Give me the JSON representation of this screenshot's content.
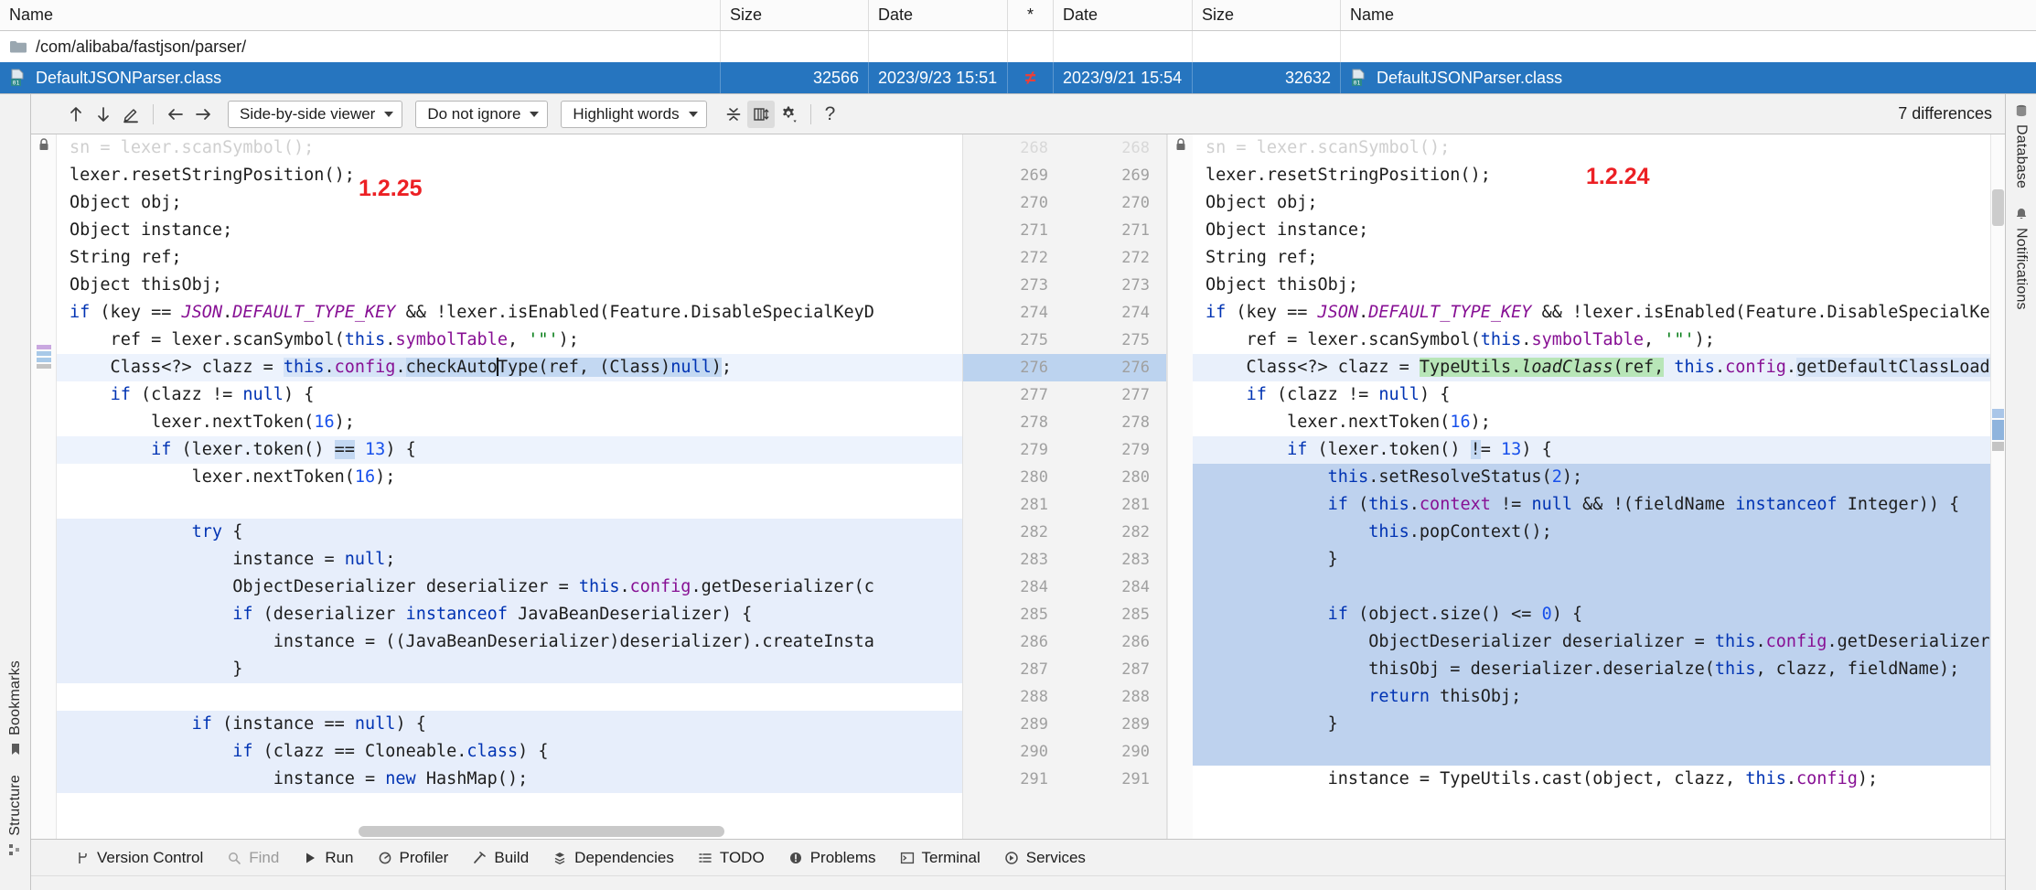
{
  "file_table": {
    "columns": [
      "Name",
      "Size",
      "Date",
      "*",
      "Date",
      "Size",
      "Name"
    ],
    "folder_row": {
      "path": "/com/alibaba/fastjson/parser/"
    },
    "selected_row": {
      "left_name": "DefaultJSONParser.class",
      "left_size": "32566",
      "left_date": "2023/9/23 15:51",
      "status": "≠",
      "right_date": "2023/9/21 15:54",
      "right_size": "32632",
      "right_name": "DefaultJSONParser.class"
    }
  },
  "toolbar": {
    "prev_difference": "previous-difference",
    "next_difference": "next-difference",
    "annotate": "annotate",
    "prev_file": "previous-file",
    "next_file": "next-file",
    "viewer_mode": "Side-by-side viewer",
    "ignore_mode": "Do not ignore",
    "highlight_mode": "Highlight words",
    "collapse_label": "collapse-unchanged-fragments",
    "sync_label": "synchronize-scrolling",
    "settings_label": "settings",
    "help_label": "?",
    "differences": "7 differences"
  },
  "left_rail": {
    "items": [
      {
        "label": "Bookmarks",
        "icon": "bookmark-icon"
      },
      {
        "label": "Structure",
        "icon": "structure-icon"
      }
    ]
  },
  "right_rail": {
    "items": [
      {
        "label": "Database",
        "icon": "database-icon"
      },
      {
        "label": "Notifications",
        "icon": "bell-icon"
      }
    ]
  },
  "diff": {
    "left_version_tag": "1.2.25",
    "right_version_tag": "1.2.24",
    "line_numbers": [
      "",
      "269",
      "270",
      "271",
      "272",
      "273",
      "274",
      "275",
      "276",
      "277",
      "278",
      "279",
      "280",
      "281",
      "282",
      "283",
      "284",
      "285",
      "286",
      "287",
      "288",
      "289",
      "290",
      "291"
    ],
    "left_lines": [
      {
        "text": "sn = lexer.scanSymbol();",
        "state": "dim"
      },
      {
        "text": "lexer.resetStringPosition();",
        "state": "normal"
      },
      {
        "text": "Object obj;",
        "state": "normal"
      },
      {
        "text": "Object instance;",
        "state": "normal"
      },
      {
        "text": "String ref;",
        "state": "normal"
      },
      {
        "text": "Object thisObj;",
        "state": "normal"
      },
      {
        "text": "if (key == JSON.DEFAULT_TYPE_KEY && !lexer.isEnabled(Feature.DisableSpecialKeyD",
        "state": "normal"
      },
      {
        "text": "    ref = lexer.scanSymbol(this.symbolTable, '\"');",
        "state": "normal"
      },
      {
        "text": "    Class<?> clazz = this.config.checkAutoType(ref, (Class)null);",
        "state": "changed"
      },
      {
        "text": "    if (clazz != null) {",
        "state": "normal"
      },
      {
        "text": "        lexer.nextToken(16);",
        "state": "normal"
      },
      {
        "text": "        if (lexer.token() == 13) {",
        "state": "changed-word"
      },
      {
        "text": "            lexer.nextToken(16);",
        "state": "normal"
      },
      {
        "text": "",
        "state": "normal"
      },
      {
        "text": "            try {",
        "state": "block"
      },
      {
        "text": "                instance = null;",
        "state": "block"
      },
      {
        "text": "                ObjectDeserializer deserializer = this.config.getDeserializer(c",
        "state": "block"
      },
      {
        "text": "                if (deserializer instanceof JavaBeanDeserializer) {",
        "state": "block"
      },
      {
        "text": "                    instance = ((JavaBeanDeserializer)deserializer).createInsta",
        "state": "block"
      },
      {
        "text": "                }",
        "state": "block"
      },
      {
        "text": "",
        "state": "normal"
      },
      {
        "text": "            if (instance == null) {",
        "state": "block"
      },
      {
        "text": "                if (clazz == Cloneable.class) {",
        "state": "block"
      },
      {
        "text": "                    instance = new HashMap();",
        "state": "block"
      }
    ],
    "right_lines": [
      {
        "text": "sn = lexer.scanSymbol();",
        "state": "dim"
      },
      {
        "text": "lexer.resetStringPosition();",
        "state": "normal"
      },
      {
        "text": "Object obj;",
        "state": "normal"
      },
      {
        "text": "Object instance;",
        "state": "normal"
      },
      {
        "text": "String ref;",
        "state": "normal"
      },
      {
        "text": "Object thisObj;",
        "state": "normal"
      },
      {
        "text": "if (key == JSON.DEFAULT_TYPE_KEY && !lexer.isEnabled(Feature.DisableSpecialKeyDet",
        "state": "normal"
      },
      {
        "text": "    ref = lexer.scanSymbol(this.symbolTable, '\"');",
        "state": "normal"
      },
      {
        "text": "    Class<?> clazz = TypeUtils.loadClass(ref, this.config.getDefaultClassLoader()",
        "state": "changed"
      },
      {
        "text": "    if (clazz != null) {",
        "state": "normal"
      },
      {
        "text": "        lexer.nextToken(16);",
        "state": "normal"
      },
      {
        "text": "        if (lexer.token() != 13) {",
        "state": "changed-word"
      },
      {
        "text": "            this.setResolveStatus(2);",
        "state": "block"
      },
      {
        "text": "            if (this.context != null && !(fieldName instanceof Integer)) {",
        "state": "block"
      },
      {
        "text": "                this.popContext();",
        "state": "block"
      },
      {
        "text": "            }",
        "state": "block"
      },
      {
        "text": "",
        "state": "block"
      },
      {
        "text": "            if (object.size() <= 0) {",
        "state": "block"
      },
      {
        "text": "                ObjectDeserializer deserializer = this.config.getDeserializer(cla",
        "state": "block"
      },
      {
        "text": "                thisObj = deserializer.deserialze(this, clazz, fieldName);",
        "state": "block"
      },
      {
        "text": "                return thisObj;",
        "state": "block"
      },
      {
        "text": "            }",
        "state": "block"
      },
      {
        "text": "",
        "state": "block"
      },
      {
        "text": "            instance = TypeUtils.cast(object, clazz, this.config);",
        "state": "normal"
      }
    ],
    "highlight_left": "checkAutoType",
    "highlight_right": "TypeUtils.loadClass(ref,"
  },
  "status_bar": {
    "items": [
      {
        "label": "Version Control",
        "icon": "branch-icon",
        "muted": false
      },
      {
        "label": "Find",
        "icon": "search-icon",
        "muted": true
      },
      {
        "label": "Run",
        "icon": "play-icon",
        "muted": false
      },
      {
        "label": "Profiler",
        "icon": "profiler-icon",
        "muted": false
      },
      {
        "label": "Build",
        "icon": "hammer-icon",
        "muted": false
      },
      {
        "label": "Dependencies",
        "icon": "dependencies-icon",
        "muted": false
      },
      {
        "label": "TODO",
        "icon": "todo-icon",
        "muted": false
      },
      {
        "label": "Problems",
        "icon": "problems-icon",
        "muted": false
      },
      {
        "label": "Terminal",
        "icon": "terminal-icon",
        "muted": false
      },
      {
        "label": "Services",
        "icon": "services-icon",
        "muted": false
      }
    ]
  },
  "colors": {
    "selection_blue": "#2675bf",
    "diff_block_left": "#e7eefb",
    "diff_block_right": "#bed2ee",
    "word_change_blue": "#c3d8f2",
    "word_change_green": "#b8e6b8",
    "annotation_red": "#ec2024",
    "arrow_red": "#e02020"
  }
}
